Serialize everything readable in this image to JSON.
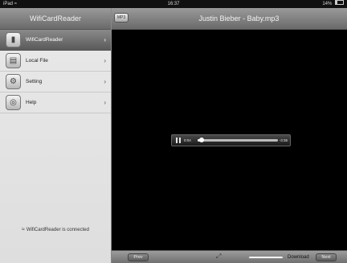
{
  "statusbar": {
    "device": "iPad",
    "wifi_icon": "wifi-icon",
    "time": "16:37",
    "battery": "14%"
  },
  "sidebar": {
    "title": "WifiCardReader",
    "items": [
      {
        "label": "WifiCardReader",
        "icon": "card-reader-icon",
        "active": true
      },
      {
        "label": "Local File",
        "icon": "briefcase-icon",
        "active": false
      },
      {
        "label": "Setting",
        "icon": "settings-icon",
        "active": false
      },
      {
        "label": "Help",
        "icon": "lifebuoy-icon",
        "active": false
      }
    ],
    "connection_status": "WifiCardReader is connected"
  },
  "main": {
    "badge": "MP3",
    "title": "Justin Bieber - Baby.mp3",
    "player": {
      "elapsed": "0:04",
      "remaining": "-3:36",
      "progress": 0.05
    }
  },
  "toolbar": {
    "prev_label": "Prev",
    "next_label": "Next",
    "download_label": "Download",
    "download_progress": 0.0
  },
  "colors": {
    "toolbar_gradient_top": "#9a9a9a",
    "toolbar_gradient_bottom": "#6a6a6a",
    "sidebar_bg": "#e4e4e4",
    "content_bg": "#000000"
  }
}
